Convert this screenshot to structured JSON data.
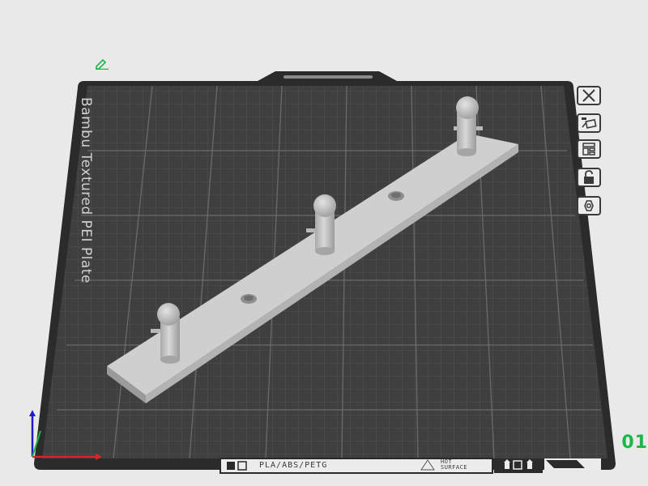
{
  "plate": {
    "label": "Bambu Textured PEI Plate",
    "material_label": "PLA/ABS/PETG",
    "hot_surface_label": "HOT\nSURFACE",
    "plate_number": "01"
  },
  "toolbar": {
    "close_icon": "close-icon",
    "auto_orient_icon": "auto-orient-icon",
    "arrange_icon": "arrange-icon",
    "lock_icon": "lock-icon",
    "settings_icon": "hexagon-settings-icon"
  },
  "colors": {
    "plate": "#3d3d3d",
    "grid": "#5a5a5a",
    "frame": "#2a2a2a",
    "model": "#c8c8c8",
    "accent_green": "#1db64a",
    "background": "#e9e9e9"
  }
}
